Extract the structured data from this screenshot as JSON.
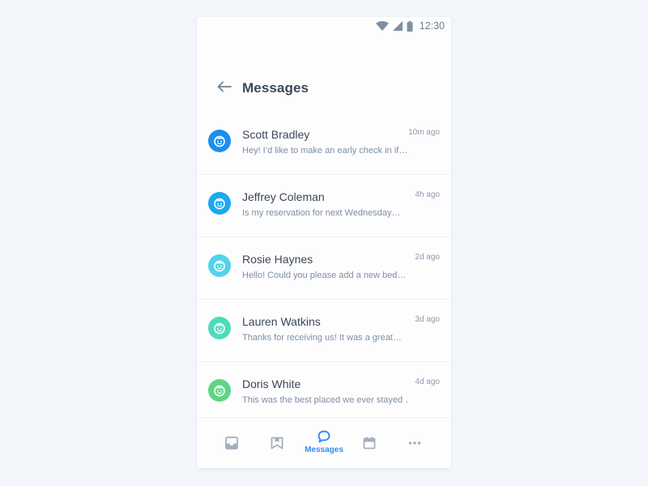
{
  "status_bar": {
    "time": "12:30",
    "icons": [
      "wifi-icon",
      "signal-icon",
      "battery-icon"
    ]
  },
  "header": {
    "back_icon": "arrow-left-icon",
    "title": "Messages"
  },
  "messages": [
    {
      "sender": "Scott Bradley",
      "preview": "Hey! I’d like to make an early check in if…",
      "time": "10m ago",
      "avatar_color": "#1b8ff0",
      "avatar_icon": "user-face-icon"
    },
    {
      "sender": "Jeffrey Coleman",
      "preview": "Is my reservation for next Wednesday…",
      "time": "4h ago",
      "avatar_color": "#1aa8f2",
      "avatar_icon": "user-face-icon"
    },
    {
      "sender": "Rosie Haynes",
      "preview": "Hello! Could you please add a new bed…",
      "time": "2d ago",
      "avatar_color": "#52d3e8",
      "avatar_icon": "user-face-icon"
    },
    {
      "sender": "Lauren Watkins",
      "preview": "Thanks for receiving us! It was a great…",
      "time": "3d ago",
      "avatar_color": "#4cdcbc",
      "avatar_icon": "user-face-icon"
    },
    {
      "sender": "Doris White",
      "preview": "This was the best placed we ever stayed …",
      "time": "4d ago",
      "avatar_color": "#5cd685",
      "avatar_icon": "user-face-icon"
    }
  ],
  "bottom_nav": {
    "items": [
      {
        "icon": "inbox-icon",
        "label": ""
      },
      {
        "icon": "bookmark-icon",
        "label": ""
      },
      {
        "icon": "chat-bubble-icon",
        "label": "Messages",
        "active": true
      },
      {
        "icon": "calendar-icon",
        "label": ""
      },
      {
        "icon": "more-icon",
        "label": ""
      }
    ]
  },
  "colors": {
    "background": "#f3f6fa",
    "accent": "#2f8df0",
    "icon_inactive": "#a3afbd",
    "title": "#3d4a5a"
  }
}
